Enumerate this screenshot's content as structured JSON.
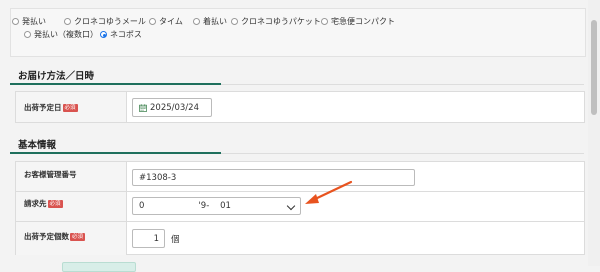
{
  "shipping_methods": {
    "options": [
      {
        "label": "発払い",
        "selected": false
      },
      {
        "label": "クロネコゆうメール",
        "selected": false
      },
      {
        "label": "タイム",
        "selected": false
      },
      {
        "label": "着払い",
        "selected": false
      },
      {
        "label": "クロネコゆうパケット",
        "selected": false
      },
      {
        "label": "宅急便コンパクト",
        "selected": false
      },
      {
        "label": "発払い（複数口）",
        "selected": false
      },
      {
        "label": "ネコポス",
        "selected": true
      }
    ]
  },
  "delivery_section": {
    "title": "お届け方法／日時",
    "ship_date": {
      "label": "出荷予定日",
      "required_badge": "必須",
      "value": "2025/03/24"
    }
  },
  "basic_info_section": {
    "title": "基本情報",
    "customer_number": {
      "label": "お客様管理番号",
      "value": "#1308-3"
    },
    "billing": {
      "label": "請求先",
      "required_badge": "必須",
      "selected_value": "0                    '9-    01"
    },
    "quantity": {
      "label": "出荷予定個数",
      "required_badge": "必須",
      "value": "1",
      "unit": "個"
    }
  },
  "colors": {
    "accent": "#1e6f5c",
    "arrow": "#e8531f",
    "required": "#d9534f",
    "radio_selected": "#1a73e8"
  }
}
